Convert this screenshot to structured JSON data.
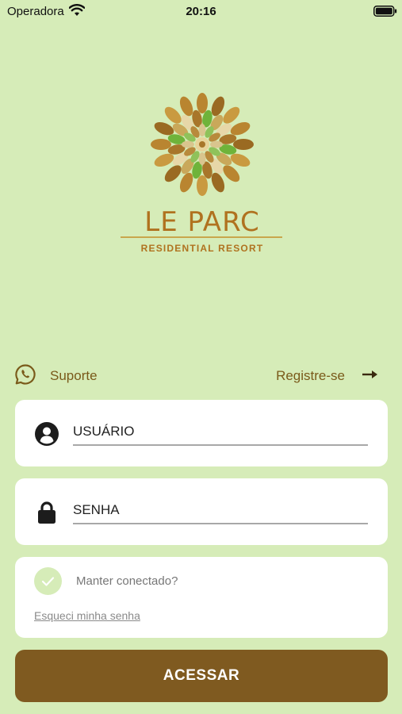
{
  "status_bar": {
    "carrier": "Operadora",
    "time": "20:16",
    "icons": [
      "wifi-icon",
      "battery-icon"
    ]
  },
  "logo": {
    "title": "LE PARC",
    "subtitle": "RESIDENTIAL RESORT"
  },
  "links": {
    "support_label": "Suporte",
    "support_icon": "whatsapp-icon",
    "register_label": "Registre-se",
    "register_icon": "arrow-right-icon"
  },
  "form": {
    "username_placeholder": "USUÁRIO",
    "username_value": "",
    "username_icon": "user-icon",
    "password_placeholder": "SENHA",
    "password_value": "",
    "password_icon": "lock-icon",
    "keep_logged_label": "Manter conectado?",
    "keep_logged_checked": false,
    "forgot_label": "Esqueci minha senha",
    "submit_label": "ACESSAR"
  },
  "colors": {
    "background": "#d6ecb8",
    "accent": "#7f5a20",
    "link_text": "#7a5a1a",
    "logo_gold": "#b0721f"
  }
}
